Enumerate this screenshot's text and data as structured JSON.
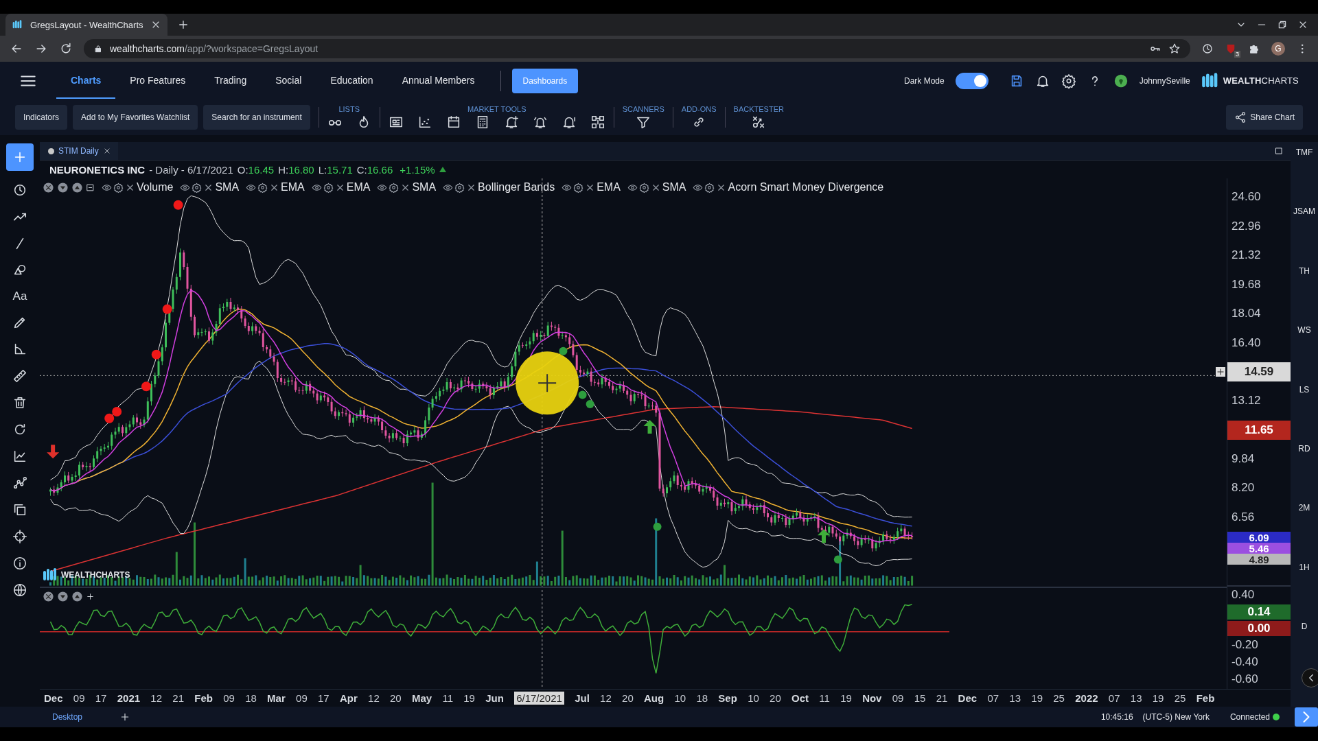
{
  "browser": {
    "tab_title": "GregsLayout - WealthCharts",
    "url_host": "wealthcharts.com",
    "url_path": "/app/?workspace=GregsLayout",
    "extension_badge": "3",
    "profile_initial": "G"
  },
  "nav": {
    "items": [
      {
        "label": "Charts",
        "selected": true
      },
      {
        "label": "Pro Features",
        "selected": false
      },
      {
        "label": "Trading",
        "selected": false
      },
      {
        "label": "Social",
        "selected": false
      },
      {
        "label": "Education",
        "selected": false
      },
      {
        "label": "Annual Members",
        "selected": false
      }
    ],
    "dashboards": "Dashboards",
    "dark_mode": {
      "label": "Dark Mode",
      "on": true
    },
    "username": "JohnnySeville",
    "logo": "**WEALTH**CHARTS"
  },
  "toolbar": {
    "buttons": [
      "Indicators",
      "Add to My Favorites Watchlist",
      "Search for an instrument"
    ],
    "groups": [
      "LISTS",
      "MARKET TOOLS",
      "SCANNERS",
      "ADD-ONS",
      "BACKTESTER"
    ],
    "share_button": "Share Chart"
  },
  "sidebar": {
    "text_tool": "Aa"
  },
  "chart_tab": {
    "label": "STIM Daily"
  },
  "legend": {
    "name": "NEURONETICS INC",
    "details": "- Daily - 6/17/2021",
    "ohlc": [
      {
        "key": "O:",
        "value": "16.45"
      },
      {
        "key": "H:",
        "value": "16.80"
      },
      {
        "key": "L:",
        "value": "15.71"
      },
      {
        "key": "C:",
        "value": "16.66"
      }
    ],
    "change": "+1.15%"
  },
  "indicators": [
    "Volume",
    "SMA",
    "EMA",
    "EMA",
    "SMA",
    "Bollinger Bands",
    "EMA",
    "SMA",
    "Acorn Smart Money Divergence"
  ],
  "chart_logo": "WEALTHCHARTS",
  "price_axis": {
    "items": [
      {
        "kind": "tick",
        "text": "24.60"
      },
      {
        "kind": "tick",
        "text": "22.96"
      },
      {
        "kind": "tick",
        "text": "21.32"
      },
      {
        "kind": "tick",
        "text": "19.68"
      },
      {
        "kind": "tick",
        "text": "18.04"
      },
      {
        "kind": "tick",
        "text": "16.40"
      },
      {
        "kind": "badge",
        "text": "14.59",
        "color": "#d9d9d9"
      },
      {
        "kind": "tick",
        "text": "13.12"
      },
      {
        "kind": "badge",
        "text": "11.65",
        "color": "#b3261e"
      },
      {
        "kind": "tick",
        "text": "9.84"
      },
      {
        "kind": "tick",
        "text": "8.20"
      },
      {
        "kind": "tick",
        "text": "6.56"
      },
      {
        "kind": "small",
        "text": "6.09",
        "color": "#2b2bc4"
      },
      {
        "kind": "small",
        "text": "5.46",
        "color": "#9b4fe0"
      },
      {
        "kind": "small",
        "text": "4.89",
        "color": "#b8b8b8"
      }
    ],
    "lower_items": [
      {
        "kind": "tick",
        "text": "0.40"
      },
      {
        "kind": "badge",
        "text": "0.14",
        "color": "#1f6b2b"
      },
      {
        "kind": "badge",
        "text": "0.00",
        "color": "#8e1b1b"
      },
      {
        "kind": "tick",
        "text": "-0.20"
      },
      {
        "kind": "tick",
        "text": "-0.40"
      },
      {
        "kind": "tick",
        "text": "-0.60"
      }
    ]
  },
  "time_axis": [
    {
      "text": "Dec",
      "kind": "major"
    },
    {
      "text": "09",
      "kind": "minor"
    },
    {
      "text": "17",
      "kind": "minor"
    },
    {
      "text": "2021",
      "kind": "major"
    },
    {
      "text": "12",
      "kind": "minor"
    },
    {
      "text": "21",
      "kind": "minor"
    },
    {
      "text": "Feb",
      "kind": "major"
    },
    {
      "text": "09",
      "kind": "minor"
    },
    {
      "text": "18",
      "kind": "minor"
    },
    {
      "text": "Mar",
      "kind": "major"
    },
    {
      "text": "09",
      "kind": "minor"
    },
    {
      "text": "17",
      "kind": "minor"
    },
    {
      "text": "Apr",
      "kind": "major"
    },
    {
      "text": "12",
      "kind": "minor"
    },
    {
      "text": "20",
      "kind": "minor"
    },
    {
      "text": "May",
      "kind": "major"
    },
    {
      "text": "11",
      "kind": "minor"
    },
    {
      "text": "19",
      "kind": "minor"
    },
    {
      "text": "Jun",
      "kind": "major"
    },
    {
      "text": "6/17/2021",
      "kind": "cursor"
    },
    {
      "text": "Jul",
      "kind": "major"
    },
    {
      "text": "12",
      "kind": "minor"
    },
    {
      "text": "20",
      "kind": "minor"
    },
    {
      "text": "Aug",
      "kind": "major"
    },
    {
      "text": "10",
      "kind": "minor"
    },
    {
      "text": "18",
      "kind": "minor"
    },
    {
      "text": "Sep",
      "kind": "major"
    },
    {
      "text": "10",
      "kind": "minor"
    },
    {
      "text": "20",
      "kind": "minor"
    },
    {
      "text": "Oct",
      "kind": "major"
    },
    {
      "text": "11",
      "kind": "minor"
    },
    {
      "text": "19",
      "kind": "minor"
    },
    {
      "text": "Nov",
      "kind": "major"
    },
    {
      "text": "09",
      "kind": "minor"
    },
    {
      "text": "15",
      "kind": "minor"
    },
    {
      "text": "21",
      "kind": "minor"
    },
    {
      "text": "Dec",
      "kind": "major"
    },
    {
      "text": "07",
      "kind": "minor"
    },
    {
      "text": "13",
      "kind": "minor"
    },
    {
      "text": "19",
      "kind": "minor"
    },
    {
      "text": "25",
      "kind": "minor"
    },
    {
      "text": "2022",
      "kind": "major"
    },
    {
      "text": "07",
      "kind": "minor"
    },
    {
      "text": "13",
      "kind": "minor"
    },
    {
      "text": "19",
      "kind": "minor"
    },
    {
      "text": "25",
      "kind": "minor"
    },
    {
      "text": "Feb",
      "kind": "major"
    }
  ],
  "right_rail": [
    "TMF",
    "JSAM",
    "TH",
    "WS",
    "LS",
    "RD",
    "2M",
    "1H",
    "D"
  ],
  "footer": {
    "workspace_tab": "Desktop",
    "time": "10:45:16",
    "timezone": "(UTC-5) New York",
    "status": "Connected",
    "connected": true
  }
}
